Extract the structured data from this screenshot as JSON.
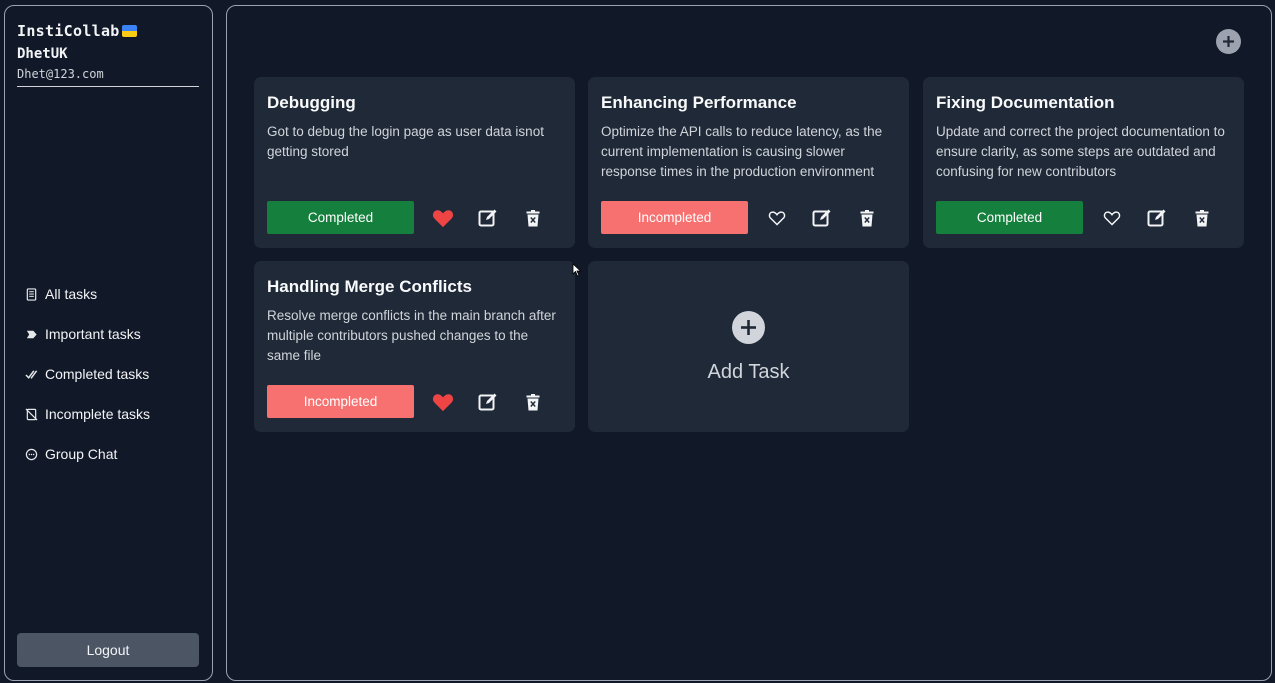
{
  "sidebar": {
    "app_name": "InstiCollab",
    "username": "DhetUK",
    "email": "Dhet@123.com",
    "nav": [
      {
        "label": "All tasks",
        "icon": "notes-icon"
      },
      {
        "label": "Important tasks",
        "icon": "tag-icon"
      },
      {
        "label": "Completed tasks",
        "icon": "double-check-icon"
      },
      {
        "label": "Incomplete tasks",
        "icon": "note-off-icon"
      },
      {
        "label": "Group Chat",
        "icon": "chat-icon"
      }
    ],
    "logout_label": "Logout"
  },
  "colors": {
    "background": "#111827",
    "card": "#1f2937",
    "completed": "#15803d",
    "incompleted": "#f87171",
    "heart": "#ef4444"
  },
  "tasks": [
    {
      "title": "Debugging",
      "description": "Got to debug the login page as user data isnot getting stored",
      "status": "Completed",
      "important": true
    },
    {
      "title": "Enhancing Performance",
      "description": "Optimize the API calls to reduce latency, as the current implementation is causing slower response times in the production environment",
      "status": "Incompleted",
      "important": false
    },
    {
      "title": "Fixing Documentation",
      "description": "Update and correct the project documentation to ensure clarity, as some steps are outdated and confusing for new contributors",
      "status": "Completed",
      "important": false
    },
    {
      "title": "Handling Merge Conflicts",
      "description": "Resolve merge conflicts in the main branch after multiple contributors pushed changes to the same file",
      "status": "Incompleted",
      "important": true
    }
  ],
  "add_task": {
    "label": "Add Task"
  }
}
